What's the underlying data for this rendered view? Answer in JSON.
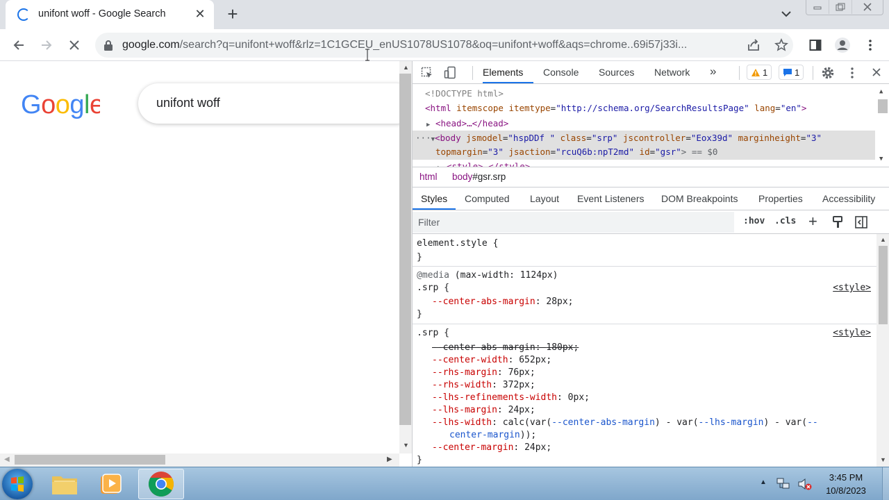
{
  "browser": {
    "tab_title": "unifont woff - Google Search",
    "tab_close": "✕",
    "new_tab": "+",
    "url_host": "google.com",
    "url_path": "/search?q=unifont+woff&rlz=1C1GCEU_enUS1078US1078&oq=unifont+woff&aqs=chrome..69i57j33i..."
  },
  "page": {
    "search_text": "unifont woff"
  },
  "devtools": {
    "tabs": [
      "Elements",
      "Console",
      "Sources",
      "Network"
    ],
    "more": "»",
    "warn_count": "1",
    "msg_count": "1",
    "elements": {
      "doctype": "<!DOCTYPE html>",
      "html_open": "<html",
      "html_attr1": "itemscope",
      "html_attr2": "itemtype",
      "html_val2": "\"http://schema.org/SearchResultsPage\"",
      "html_attr3": "lang",
      "html_val3": "\"en\"",
      "html_close": ">",
      "head": "<head>…</head>",
      "dots": "···",
      "body_open": "<body",
      "b_attr1": "jsmodel",
      "b_val1": "\"hspDDf \"",
      "b_attr2": "class",
      "b_val2": "\"srp\"",
      "b_attr3": "jscontroller",
      "b_val3": "\"Eox39d\"",
      "b_attr4": "marginheight",
      "b_val4": "\"3\"",
      "b_attr5": "topmargin",
      "b_val5": "\"3\"",
      "b_attr6": "jsaction",
      "b_val6": "\"rcuQ6b:npT2md\"",
      "b_attr7": "id",
      "b_val7": "\"gsr\"",
      "b_eq": "> == $0",
      "style_line": "<style>…</style>"
    },
    "breadcrumbs": [
      "html",
      "body",
      "#gsr.srp"
    ],
    "subtabs": [
      "Styles",
      "Computed",
      "Layout",
      "Event Listeners",
      "DOM Breakpoints",
      "Properties",
      "Accessibility"
    ],
    "filter_placeholder": "Filter",
    "hov": ":hov",
    "cls": ".cls",
    "plus": "+",
    "styles": {
      "element_style": "element.style {",
      "close_brace": "}",
      "media": "@media",
      "media_cond": "(max-width: 1124px)",
      "srp_sel": ".srp {",
      "source": "<style>",
      "rule1": [
        {
          "prop": "--center-abs-margin",
          "value": "28px;"
        }
      ],
      "rule2": [
        {
          "prop": "--center-abs-margin",
          "value": "180px;",
          "struck": true
        },
        {
          "prop": "--center-width",
          "value": "652px;"
        },
        {
          "prop": "--rhs-margin",
          "value": "76px;"
        },
        {
          "prop": "--rhs-width",
          "value": "372px;"
        },
        {
          "prop": "--lhs-refinements-width",
          "value": "0px;"
        },
        {
          "prop": "--lhs-margin",
          "value": "24px;"
        }
      ],
      "lhs_width_prop": "--lhs-width",
      "lhs_width_calc": "calc(var(",
      "lhs_width_v1": "--center-abs-margin",
      "lhs_width_mid": ") - var(",
      "lhs_width_v2": "--lhs-margin",
      "lhs_width_mid2": ") - var(",
      "lhs_width_v3a": "--",
      "lhs_width_v3b": "center-margin",
      "lhs_width_end": "));",
      "center_margin_prop": "--center-margin",
      "center_margin_val": "24px;"
    }
  },
  "taskbar": {
    "time": "3:45 PM",
    "date": "10/8/2023"
  },
  "colors": {
    "accent": "#1a73e8",
    "warn": "#f29900"
  }
}
